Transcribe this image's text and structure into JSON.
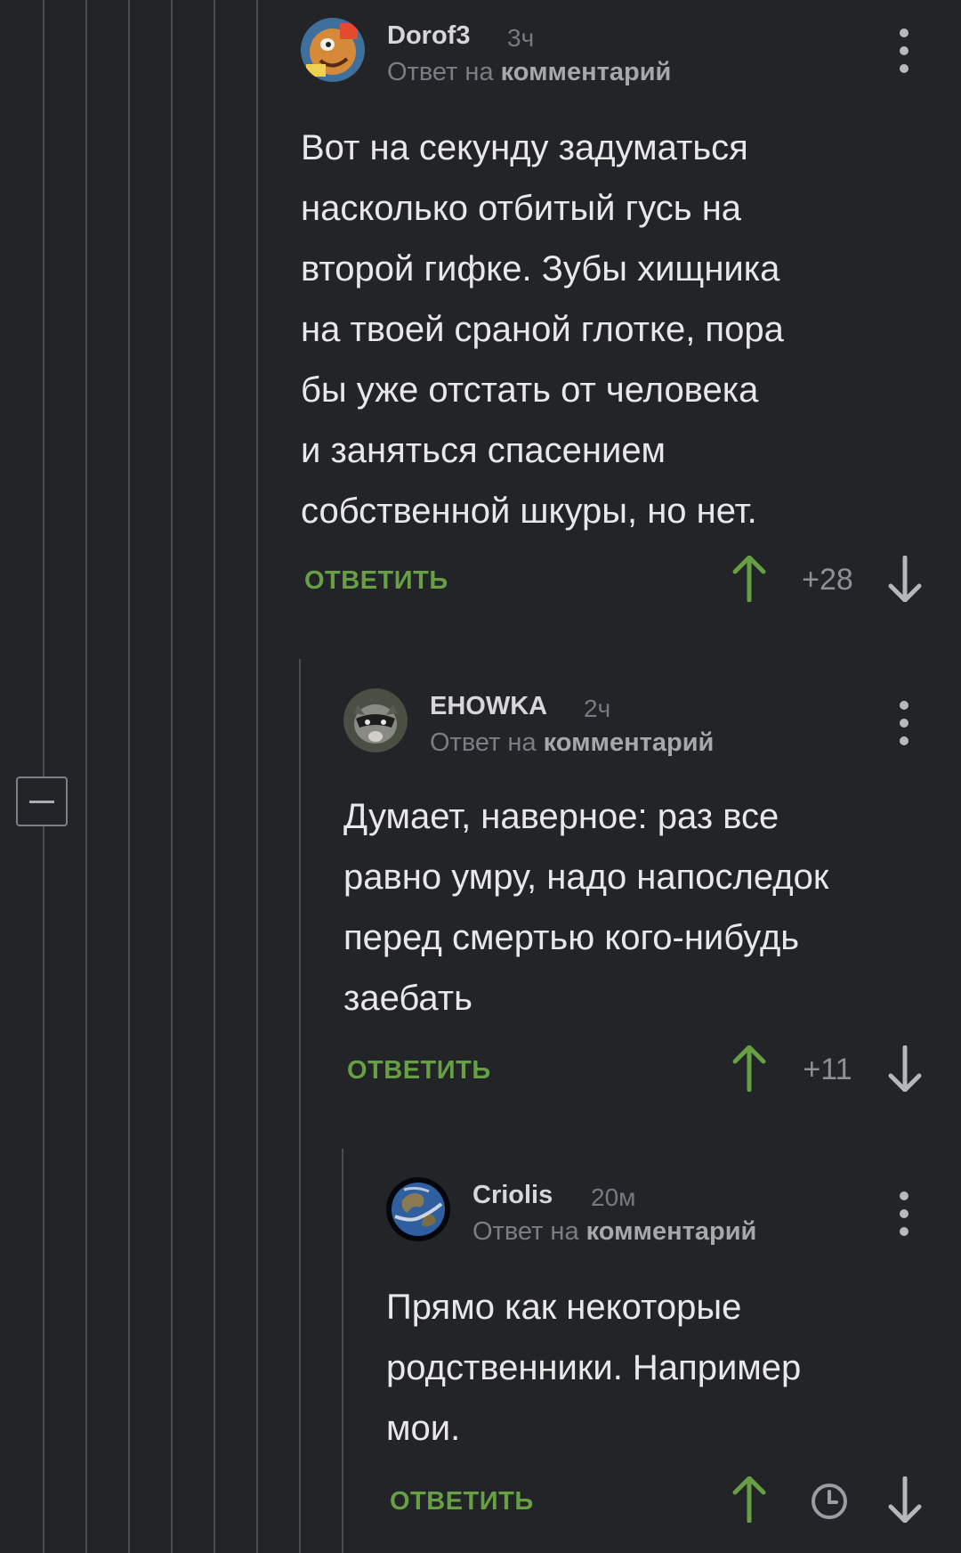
{
  "colors": {
    "background": "#222427",
    "thread_line": "#4a4c50",
    "reply_green": "#67a044",
    "text": "#e8e8e8",
    "muted": "#7a7d81"
  },
  "comments": [
    {
      "username": "Dorof3",
      "time": "3ч",
      "reply_prefix": "Ответ на",
      "reply_target": "комментарий",
      "text": "Вот на секунду задуматься\nнасколько отбитый гусь на\nвторой гифке. Зубы хищника\nна твоей сраной глотке, пора\nбы уже отстать от человека\nи заняться спасением\nсобственной шкуры, но нет.",
      "reply_label": "ОТВЕТИТЬ",
      "rating": "+28",
      "avatar_icon": "cartoon-avatar"
    },
    {
      "username": "EHOWKA",
      "time": "2ч",
      "reply_prefix": "Ответ на",
      "reply_target": "комментарий",
      "text": "Думает, наверное: раз все\nравно умру, надо напоследок\nперед смертью кого-нибудь\nзаебать",
      "reply_label": "ОТВЕТИТЬ",
      "rating": "+11",
      "avatar_icon": "raccoon-avatar"
    },
    {
      "username": "Criolis",
      "time": "20м",
      "reply_prefix": "Ответ на",
      "reply_target": "комментарий",
      "text": "Прямо как некоторые\nродственники. Например\nмои.",
      "reply_label": "ОТВЕТИТЬ",
      "rating_icon": "clock-icon",
      "avatar_icon": "earth-avatar"
    }
  ]
}
